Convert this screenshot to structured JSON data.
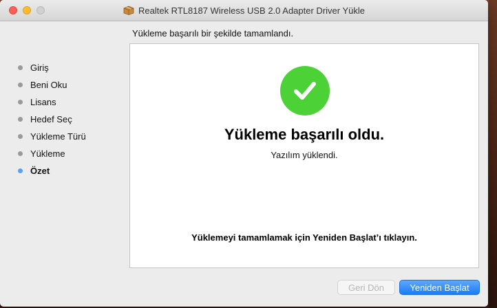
{
  "window": {
    "title": "Realtek RTL8187 Wireless USB 2.0 Adapter Driver Yükle",
    "title_icon": "package-icon"
  },
  "headline": "Yükleme başarılı bir şekilde tamamlandı.",
  "sidebar": {
    "items": [
      {
        "label": "Giriş",
        "active": false
      },
      {
        "label": "Beni Oku",
        "active": false
      },
      {
        "label": "Lisans",
        "active": false
      },
      {
        "label": "Hedef Seç",
        "active": false
      },
      {
        "label": "Yükleme Türü",
        "active": false
      },
      {
        "label": "Yükleme",
        "active": false
      },
      {
        "label": "Özet",
        "active": true
      }
    ]
  },
  "content": {
    "status_icon": "checkmark-icon",
    "title": "Yükleme başarılı oldu.",
    "subtitle": "Yazılım yüklendi.",
    "note": "Yüklemeyi tamamlamak için Yeniden Başlat’ı tıklayın."
  },
  "buttons": {
    "back": "Geri Dön",
    "restart": "Yeniden Başlat"
  },
  "colors": {
    "success": "#4cd137",
    "active_step": "#5a9ef5",
    "primary_button": "#1a7cf5"
  }
}
